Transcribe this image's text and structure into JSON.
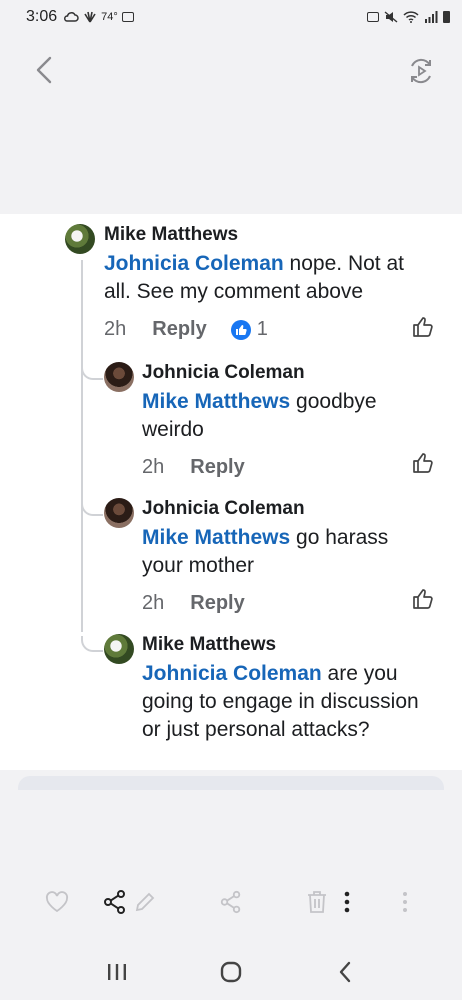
{
  "status_bar": {
    "time": "3:06",
    "temp": "74°"
  },
  "comments": [
    {
      "author": "Mike Matthews",
      "mention": "Johnicia Coleman",
      "text": " nope. Not at all. See my comment above",
      "time": "2h",
      "reply_label": "Reply",
      "reaction_count": "1"
    },
    {
      "author": "Johnicia Coleman",
      "mention": "Mike Matthews",
      "text": " goodbye weirdo",
      "time": "2h",
      "reply_label": "Reply"
    },
    {
      "author": "Johnicia Coleman",
      "mention": "Mike Matthews",
      "text": " go harass your mother",
      "time": "2h",
      "reply_label": "Reply"
    },
    {
      "author": "Mike Matthews",
      "mention": "Johnicia Coleman",
      "text": " are you going to engage in discussion or just personal attacks?"
    }
  ],
  "icons": {
    "back": "chevron-left-icon",
    "rotate": "rotate-screen-icon",
    "like": "thumbs-up-icon",
    "favorite": "heart-icon",
    "share": "share-icon",
    "edit": "pencil-icon",
    "delete": "trash-icon",
    "more": "more-vertical-icon"
  },
  "colors": {
    "mention": "#1766b8",
    "reaction": "#1877f2",
    "meta": "#65676b"
  }
}
